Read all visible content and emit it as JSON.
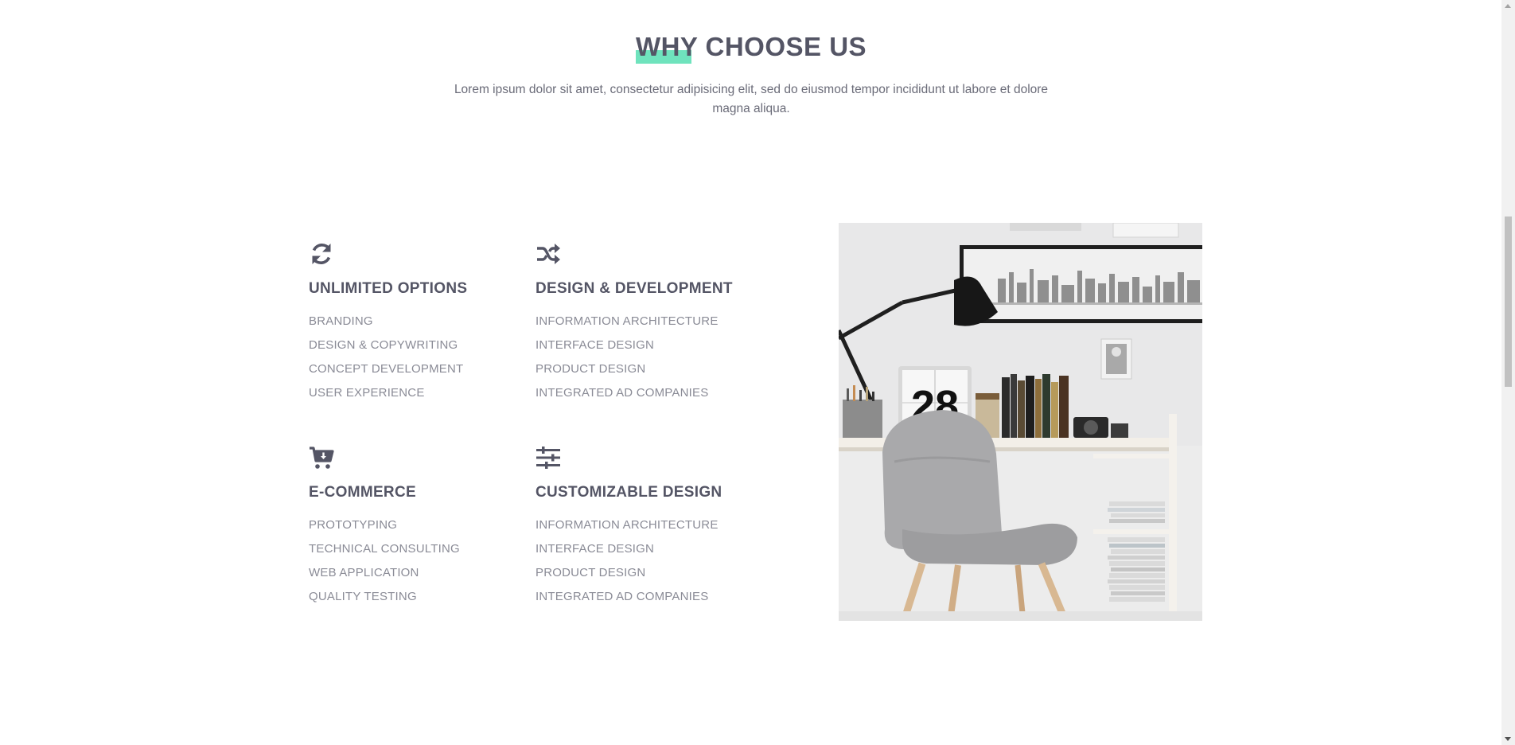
{
  "section": {
    "title": "WHY CHOOSE US",
    "subtitle": "Lorem ipsum dolor sit amet, consectetur adipisicing elit, sed do eiusmod tempor incididunt ut labore et dolore magna aliqua."
  },
  "colors": {
    "accent": "#6fe3bd",
    "heading": "#545565",
    "body_text": "#6a6b78",
    "list_text": "#8a8b96"
  },
  "features": [
    {
      "icon": "refresh-icon",
      "title": "UNLIMITED OPTIONS",
      "items": [
        "BRANDING",
        "DESIGN & COPYWRITING",
        "CONCEPT DEVELOPMENT",
        "USER EXPERIENCE"
      ]
    },
    {
      "icon": "shuffle-icon",
      "title": "DESIGN & DEVELOPMENT",
      "items": [
        "INFORMATION ARCHITECTURE",
        "INTERFACE DESIGN",
        "PRODUCT DESIGN",
        "INTEGRATED AD COMPANIES"
      ]
    },
    {
      "icon": "cart-download-icon",
      "title": "E-COMMERCE",
      "items": [
        "PROTOTYPING",
        "TECHNICAL CONSULTING",
        "WEB APPLICATION",
        "QUALITY TESTING"
      ]
    },
    {
      "icon": "sliders-icon",
      "title": "CUSTOMIZABLE DESIGN",
      "items": [
        "INFORMATION ARCHITECTURE",
        "INTERFACE DESIGN",
        "PRODUCT DESIGN",
        "INTEGRATED AD COMPANIES"
      ]
    }
  ],
  "photo": {
    "calendar_number": "28"
  }
}
